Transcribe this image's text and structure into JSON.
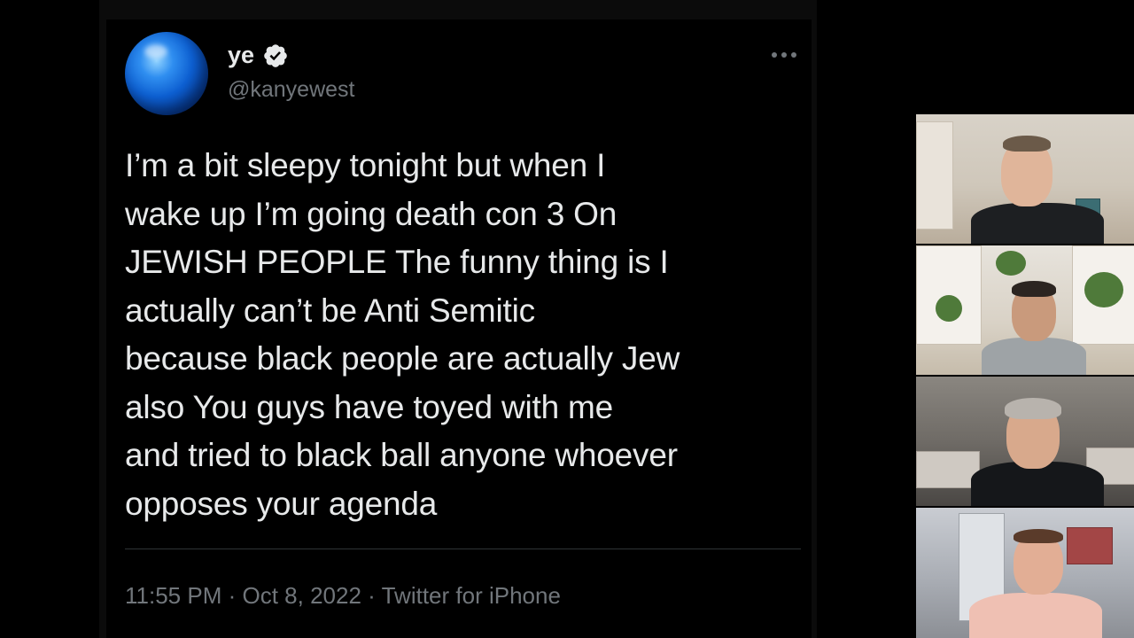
{
  "tweet": {
    "display_name": "ye",
    "handle": "@kanyewest",
    "verified": true,
    "text": "I’m a bit sleepy tonight but when I\nwake up I’m going death con 3      On\nJEWISH PEOPLE     The funny thing is I\nactually can’t be Anti Semitic\nbecause black people are actually Jew\nalso     You guys have toyed with me\nand tried to black ball anyone whoever\nopposes your agenda",
    "time": "11:55 PM",
    "date": "Oct 8, 2022",
    "source": "Twitter for iPhone",
    "separator": "·"
  },
  "icons": {
    "avatar": "blue-sphere-avatar",
    "verified": "verified-badge-icon",
    "more": "more-options-icon"
  },
  "colors": {
    "background": "#000000",
    "primary_text": "#e7e9ea",
    "secondary_text": "#71767b",
    "divider": "#2f3336"
  },
  "video_call": {
    "participants": [
      {
        "position": 1
      },
      {
        "position": 2
      },
      {
        "position": 3
      },
      {
        "position": 4
      }
    ]
  }
}
